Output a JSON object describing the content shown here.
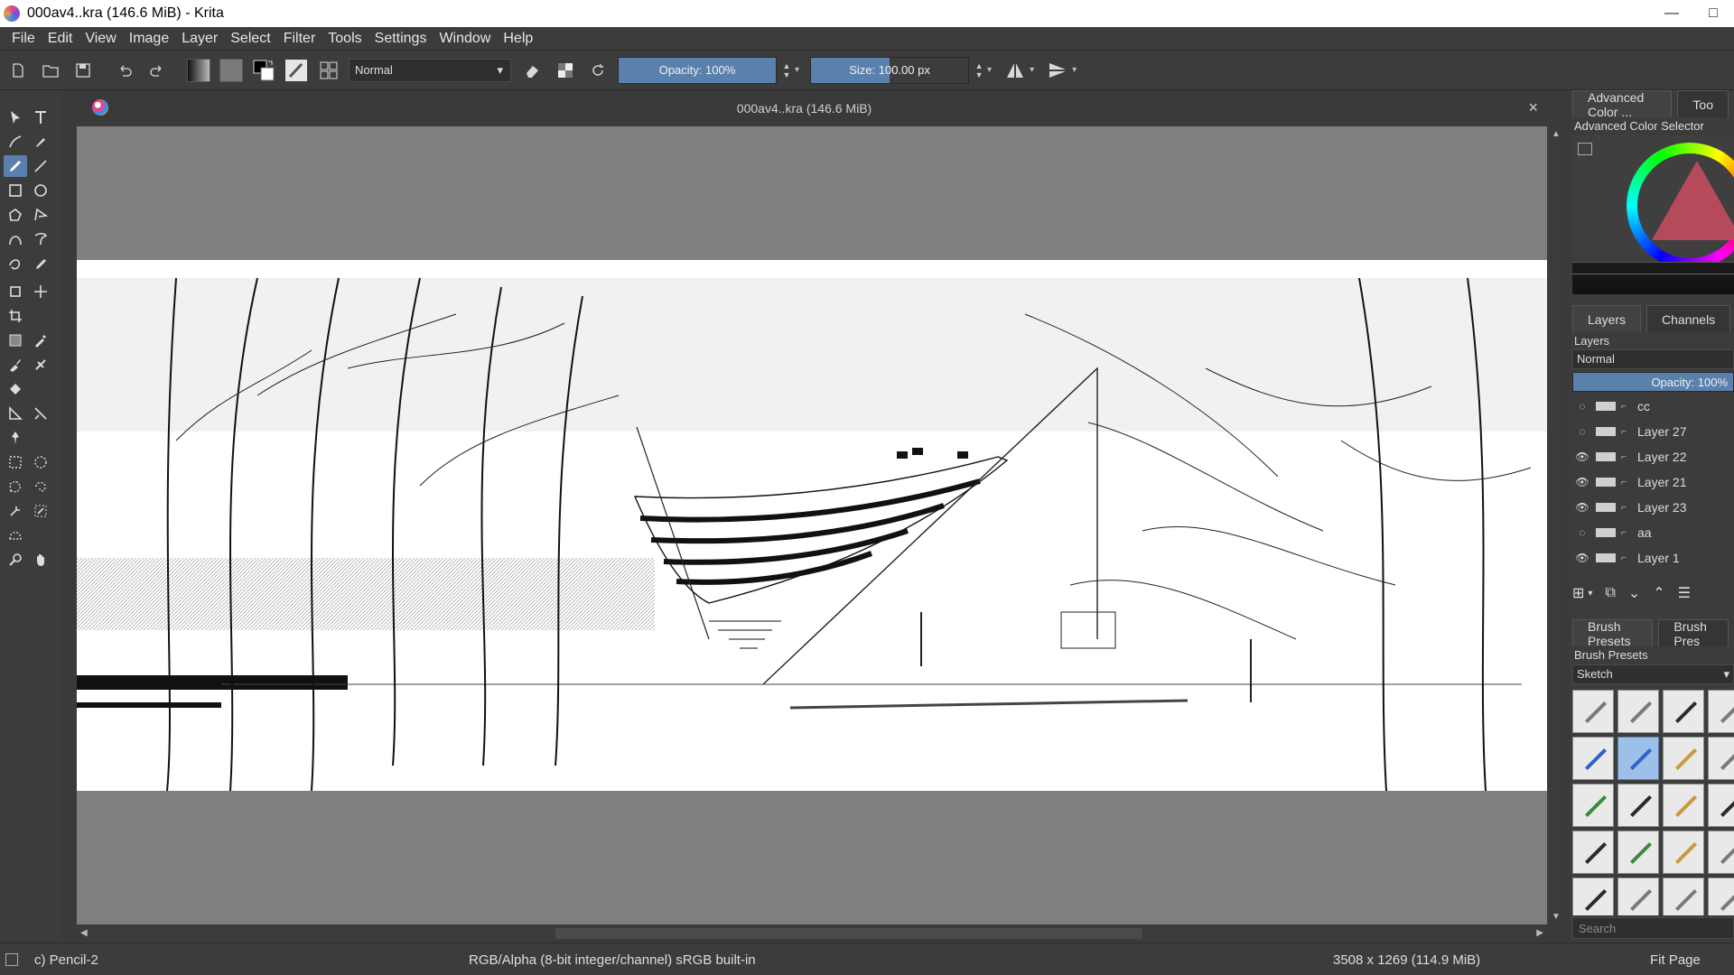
{
  "window": {
    "title": "000av4..kra (146.6 MiB)  - Krita",
    "minimize": "—",
    "maximize": "□"
  },
  "menu": [
    "File",
    "Edit",
    "View",
    "Image",
    "Layer",
    "Select",
    "Filter",
    "Tools",
    "Settings",
    "Window",
    "Help"
  ],
  "toolbar": {
    "blend_mode": "Normal",
    "opacity_label": "Opacity:",
    "opacity_value": "100%",
    "opacity_level": 1.0,
    "size_label": "Size:",
    "size_value": "100.00 px",
    "size_level": 0.5
  },
  "canvas": {
    "doc_title": "000av4..kra (146.6 MiB)",
    "close": "×"
  },
  "color_docker": {
    "tab": "Advanced Color ...",
    "tab2": "Too",
    "title": "Advanced Color Selector"
  },
  "layers_docker": {
    "tab_layers": "Layers",
    "tab_channels": "Channels",
    "title": "Layers",
    "blend_mode": "Normal",
    "opacity_label": "Opacity:",
    "opacity_value": "100%",
    "layers": [
      {
        "name": "cc",
        "visible": false
      },
      {
        "name": "Layer 27",
        "visible": false
      },
      {
        "name": "Layer 22",
        "visible": true
      },
      {
        "name": "Layer 21",
        "visible": true
      },
      {
        "name": "Layer 23",
        "visible": true
      },
      {
        "name": "aa",
        "visible": false
      },
      {
        "name": "Layer 1",
        "visible": true
      }
    ]
  },
  "brush_docker": {
    "tab1": "Brush Presets",
    "tab2": "Brush Pres",
    "title": "Brush Presets",
    "tag": "Sketch",
    "search_placeholder": "Search"
  },
  "status": {
    "brush": "c) Pencil-2",
    "color_space": "RGB/Alpha (8-bit integer/channel)  sRGB built-in",
    "dimensions": "3508 x 1269 (114.9 MiB)",
    "zoom": "Fit Page"
  },
  "colors": {
    "accent": "#5a81ad",
    "panel": "#3c3c3c",
    "canvas_bg": "#7f7f7f"
  }
}
